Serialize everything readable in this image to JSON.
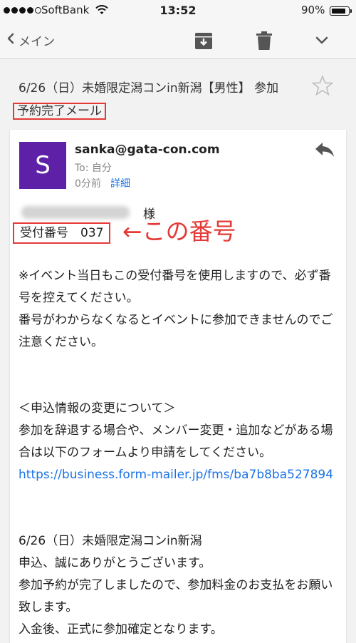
{
  "status_bar": {
    "carrier": "SoftBank",
    "time": "13:52",
    "battery_text": "90%",
    "battery_level": 0.9,
    "signal_bars": 4,
    "signal_total": 5
  },
  "toolbar": {
    "back_label": "メイン",
    "icons": [
      "chevron-left-icon",
      "archive-icon",
      "trash-icon",
      "chevron-down-icon"
    ]
  },
  "subject": {
    "text": "6/26（日）未婚限定潟コンin新潟【男性】 参加",
    "highlight": "予約完了メール"
  },
  "message": {
    "avatar_letter": "S",
    "avatar_color": "#5e20a6",
    "from": "sanka@gata-con.com",
    "to": "To: 自分",
    "time": "0分前",
    "details_link": "詳細"
  },
  "annotation": {
    "honorific": "様",
    "receipt_label": "受付番号　037",
    "arrow_text": "←この番号",
    "highlight_color": "#e53935"
  },
  "body": {
    "p1": "※イベント当日もこの受付番号を使用しますので、必ず番号を控えてください。",
    "p2": "番号がわからなくなるとイベントに参加できませんのでご注意ください。",
    "p3": "＜申込情報の変更について＞",
    "p4": "参加を辞退する場合や、メンバー変更・追加などがある場合は以下のフォームより申請をしてください。",
    "link": "https://business.form-mailer.jp/fms/ba7b8ba527894",
    "p5": "6/26（日）未婚限定潟コンin新潟",
    "p6": "申込、誠にありがとうございます。",
    "p7": "参加予約が完了しましたので、参加料金のお支払をお願い致します。",
    "p8": "入金後、正式に参加確定となります。"
  }
}
